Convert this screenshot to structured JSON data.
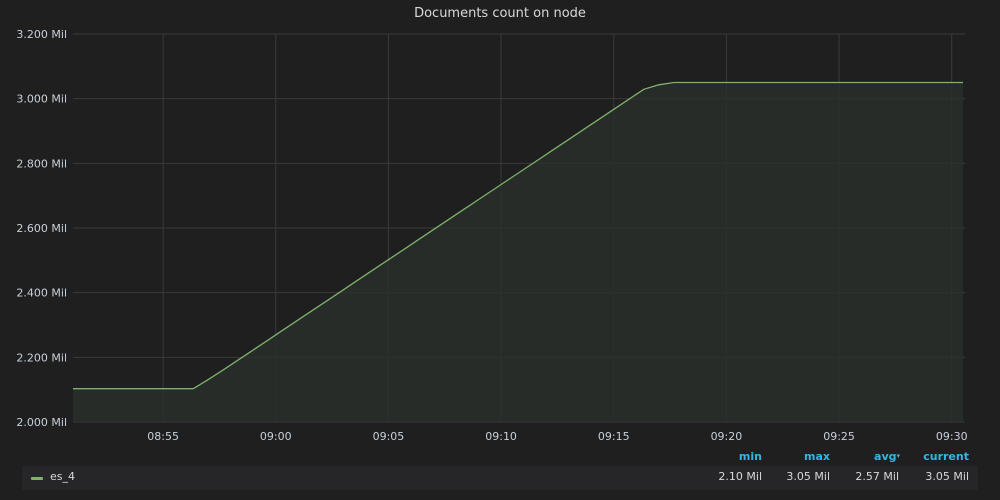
{
  "panel": {
    "title": "Documents count on node"
  },
  "colors": {
    "background": "#1f1f20",
    "grid": "#3a3a3c",
    "series": "#7eb26d",
    "fill": "#2a2f2b",
    "legend_header": "#33b5e5"
  },
  "chart_data": {
    "type": "area",
    "title": "Documents count on node",
    "xlabel": "",
    "ylabel": "",
    "y_unit": "Mil",
    "ylim": [
      2.0,
      3.2
    ],
    "xlim": [
      "08:51",
      "09:30:30"
    ],
    "y_ticks": [
      "2.000 Mil",
      "2.200 Mil",
      "2.400 Mil",
      "2.600 Mil",
      "2.800 Mil",
      "3.000 Mil",
      "3.200 Mil"
    ],
    "x_ticks": [
      "08:55",
      "09:00",
      "09:05",
      "09:10",
      "09:15",
      "09:20",
      "09:25",
      "09:30"
    ],
    "grid": true,
    "legend_position": "bottom",
    "series": [
      {
        "name": "es_4",
        "x": [
          "08:51",
          "08:52",
          "08:53",
          "08:54",
          "08:55",
          "08:56",
          "08:56:20",
          "08:57",
          "08:57:40",
          "08:58:20",
          "08:59",
          "08:59:40",
          "09:00:20",
          "09:01",
          "09:01:40",
          "09:02:20",
          "09:03",
          "09:03:40",
          "09:04:20",
          "09:05",
          "09:05:40",
          "09:06:20",
          "09:07",
          "09:07:40",
          "09:08:20",
          "09:09",
          "09:09:40",
          "09:10:20",
          "09:11",
          "09:11:40",
          "09:12:20",
          "09:13",
          "09:13:40",
          "09:14:20",
          "09:15",
          "09:15:40",
          "09:16:20",
          "09:17",
          "09:17:40",
          "09:18:20",
          "09:19",
          "09:19:40",
          "09:20:20",
          "09:21",
          "09:21:40",
          "09:22:20",
          "09:23",
          "09:23:40",
          "09:24:20",
          "09:25",
          "09:25:40",
          "09:26:20",
          "09:27",
          "09:28",
          "09:29",
          "09:30",
          "09:30:30"
        ],
        "values": [
          2.103,
          2.103,
          2.103,
          2.103,
          2.103,
          2.103,
          2.103,
          2.131,
          2.161,
          2.192,
          2.223,
          2.254,
          2.285,
          2.316,
          2.347,
          2.378,
          2.409,
          2.44,
          2.471,
          2.502,
          2.533,
          2.564,
          2.595,
          2.626,
          2.657,
          2.688,
          2.719,
          2.75,
          2.781,
          2.812,
          2.843,
          2.874,
          2.905,
          2.936,
          2.967,
          2.998,
          3.029,
          3.043,
          3.05,
          3.05,
          3.05,
          3.05,
          3.05,
          3.05,
          3.05,
          3.05,
          3.05,
          3.05,
          3.05,
          3.05,
          3.05,
          3.05,
          3.05,
          3.05,
          3.05,
          3.05,
          3.05
        ],
        "min": "2.10 Mil",
        "max": "3.05 Mil",
        "avg": "2.57 Mil",
        "current": "3.05 Mil"
      }
    ]
  },
  "legend": {
    "headers": {
      "min": "min",
      "max": "max",
      "avg": "avg",
      "current": "current"
    },
    "sort_indicator": "▾"
  }
}
